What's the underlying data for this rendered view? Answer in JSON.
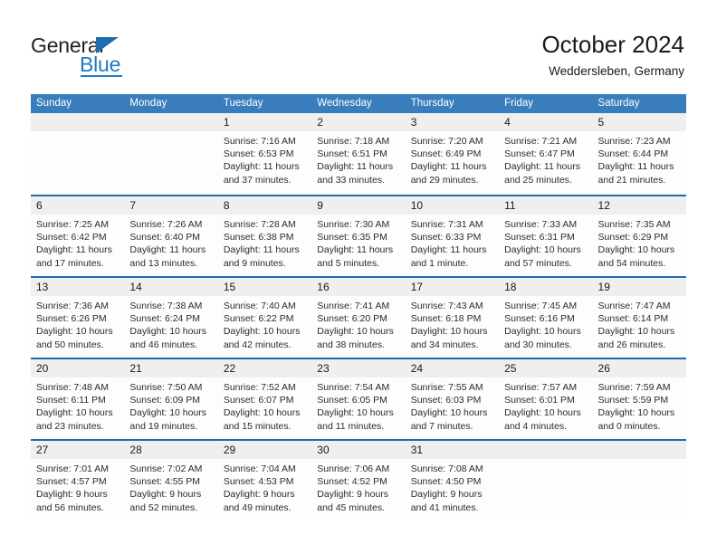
{
  "logo": {
    "word1": "General",
    "word2": "Blue",
    "triangle_color": "#1f6cb0",
    "blue_color": "#1f7ac4"
  },
  "header": {
    "title": "October 2024",
    "subtitle": "Weddersleben, Germany",
    "header_bg": "#3a7dbd",
    "row_divider": "#1f6cb0",
    "daynum_band": "#efefef"
  },
  "weekdays": [
    "Sunday",
    "Monday",
    "Tuesday",
    "Wednesday",
    "Thursday",
    "Friday",
    "Saturday"
  ],
  "weeks": [
    [
      {
        "day": "",
        "sunrise": "",
        "sunset": "",
        "daylight1": "",
        "daylight2": ""
      },
      {
        "day": "",
        "sunrise": "",
        "sunset": "",
        "daylight1": "",
        "daylight2": ""
      },
      {
        "day": "1",
        "sunrise": "Sunrise: 7:16 AM",
        "sunset": "Sunset: 6:53 PM",
        "daylight1": "Daylight: 11 hours",
        "daylight2": "and 37 minutes."
      },
      {
        "day": "2",
        "sunrise": "Sunrise: 7:18 AM",
        "sunset": "Sunset: 6:51 PM",
        "daylight1": "Daylight: 11 hours",
        "daylight2": "and 33 minutes."
      },
      {
        "day": "3",
        "sunrise": "Sunrise: 7:20 AM",
        "sunset": "Sunset: 6:49 PM",
        "daylight1": "Daylight: 11 hours",
        "daylight2": "and 29 minutes."
      },
      {
        "day": "4",
        "sunrise": "Sunrise: 7:21 AM",
        "sunset": "Sunset: 6:47 PM",
        "daylight1": "Daylight: 11 hours",
        "daylight2": "and 25 minutes."
      },
      {
        "day": "5",
        "sunrise": "Sunrise: 7:23 AM",
        "sunset": "Sunset: 6:44 PM",
        "daylight1": "Daylight: 11 hours",
        "daylight2": "and 21 minutes."
      }
    ],
    [
      {
        "day": "6",
        "sunrise": "Sunrise: 7:25 AM",
        "sunset": "Sunset: 6:42 PM",
        "daylight1": "Daylight: 11 hours",
        "daylight2": "and 17 minutes."
      },
      {
        "day": "7",
        "sunrise": "Sunrise: 7:26 AM",
        "sunset": "Sunset: 6:40 PM",
        "daylight1": "Daylight: 11 hours",
        "daylight2": "and 13 minutes."
      },
      {
        "day": "8",
        "sunrise": "Sunrise: 7:28 AM",
        "sunset": "Sunset: 6:38 PM",
        "daylight1": "Daylight: 11 hours",
        "daylight2": "and 9 minutes."
      },
      {
        "day": "9",
        "sunrise": "Sunrise: 7:30 AM",
        "sunset": "Sunset: 6:35 PM",
        "daylight1": "Daylight: 11 hours",
        "daylight2": "and 5 minutes."
      },
      {
        "day": "10",
        "sunrise": "Sunrise: 7:31 AM",
        "sunset": "Sunset: 6:33 PM",
        "daylight1": "Daylight: 11 hours",
        "daylight2": "and 1 minute."
      },
      {
        "day": "11",
        "sunrise": "Sunrise: 7:33 AM",
        "sunset": "Sunset: 6:31 PM",
        "daylight1": "Daylight: 10 hours",
        "daylight2": "and 57 minutes."
      },
      {
        "day": "12",
        "sunrise": "Sunrise: 7:35 AM",
        "sunset": "Sunset: 6:29 PM",
        "daylight1": "Daylight: 10 hours",
        "daylight2": "and 54 minutes."
      }
    ],
    [
      {
        "day": "13",
        "sunrise": "Sunrise: 7:36 AM",
        "sunset": "Sunset: 6:26 PM",
        "daylight1": "Daylight: 10 hours",
        "daylight2": "and 50 minutes."
      },
      {
        "day": "14",
        "sunrise": "Sunrise: 7:38 AM",
        "sunset": "Sunset: 6:24 PM",
        "daylight1": "Daylight: 10 hours",
        "daylight2": "and 46 minutes."
      },
      {
        "day": "15",
        "sunrise": "Sunrise: 7:40 AM",
        "sunset": "Sunset: 6:22 PM",
        "daylight1": "Daylight: 10 hours",
        "daylight2": "and 42 minutes."
      },
      {
        "day": "16",
        "sunrise": "Sunrise: 7:41 AM",
        "sunset": "Sunset: 6:20 PM",
        "daylight1": "Daylight: 10 hours",
        "daylight2": "and 38 minutes."
      },
      {
        "day": "17",
        "sunrise": "Sunrise: 7:43 AM",
        "sunset": "Sunset: 6:18 PM",
        "daylight1": "Daylight: 10 hours",
        "daylight2": "and 34 minutes."
      },
      {
        "day": "18",
        "sunrise": "Sunrise: 7:45 AM",
        "sunset": "Sunset: 6:16 PM",
        "daylight1": "Daylight: 10 hours",
        "daylight2": "and 30 minutes."
      },
      {
        "day": "19",
        "sunrise": "Sunrise: 7:47 AM",
        "sunset": "Sunset: 6:14 PM",
        "daylight1": "Daylight: 10 hours",
        "daylight2": "and 26 minutes."
      }
    ],
    [
      {
        "day": "20",
        "sunrise": "Sunrise: 7:48 AM",
        "sunset": "Sunset: 6:11 PM",
        "daylight1": "Daylight: 10 hours",
        "daylight2": "and 23 minutes."
      },
      {
        "day": "21",
        "sunrise": "Sunrise: 7:50 AM",
        "sunset": "Sunset: 6:09 PM",
        "daylight1": "Daylight: 10 hours",
        "daylight2": "and 19 minutes."
      },
      {
        "day": "22",
        "sunrise": "Sunrise: 7:52 AM",
        "sunset": "Sunset: 6:07 PM",
        "daylight1": "Daylight: 10 hours",
        "daylight2": "and 15 minutes."
      },
      {
        "day": "23",
        "sunrise": "Sunrise: 7:54 AM",
        "sunset": "Sunset: 6:05 PM",
        "daylight1": "Daylight: 10 hours",
        "daylight2": "and 11 minutes."
      },
      {
        "day": "24",
        "sunrise": "Sunrise: 7:55 AM",
        "sunset": "Sunset: 6:03 PM",
        "daylight1": "Daylight: 10 hours",
        "daylight2": "and 7 minutes."
      },
      {
        "day": "25",
        "sunrise": "Sunrise: 7:57 AM",
        "sunset": "Sunset: 6:01 PM",
        "daylight1": "Daylight: 10 hours",
        "daylight2": "and 4 minutes."
      },
      {
        "day": "26",
        "sunrise": "Sunrise: 7:59 AM",
        "sunset": "Sunset: 5:59 PM",
        "daylight1": "Daylight: 10 hours",
        "daylight2": "and 0 minutes."
      }
    ],
    [
      {
        "day": "27",
        "sunrise": "Sunrise: 7:01 AM",
        "sunset": "Sunset: 4:57 PM",
        "daylight1": "Daylight: 9 hours",
        "daylight2": "and 56 minutes."
      },
      {
        "day": "28",
        "sunrise": "Sunrise: 7:02 AM",
        "sunset": "Sunset: 4:55 PM",
        "daylight1": "Daylight: 9 hours",
        "daylight2": "and 52 minutes."
      },
      {
        "day": "29",
        "sunrise": "Sunrise: 7:04 AM",
        "sunset": "Sunset: 4:53 PM",
        "daylight1": "Daylight: 9 hours",
        "daylight2": "and 49 minutes."
      },
      {
        "day": "30",
        "sunrise": "Sunrise: 7:06 AM",
        "sunset": "Sunset: 4:52 PM",
        "daylight1": "Daylight: 9 hours",
        "daylight2": "and 45 minutes."
      },
      {
        "day": "31",
        "sunrise": "Sunrise: 7:08 AM",
        "sunset": "Sunset: 4:50 PM",
        "daylight1": "Daylight: 9 hours",
        "daylight2": "and 41 minutes."
      },
      {
        "day": "",
        "sunrise": "",
        "sunset": "",
        "daylight1": "",
        "daylight2": ""
      },
      {
        "day": "",
        "sunrise": "",
        "sunset": "",
        "daylight1": "",
        "daylight2": ""
      }
    ]
  ]
}
